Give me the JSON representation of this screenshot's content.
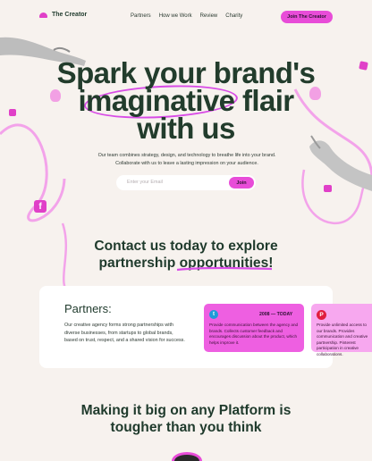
{
  "brand": {
    "name": "The Creator"
  },
  "nav": {
    "items": [
      "Partners",
      "How we Work",
      "Review",
      "Charity"
    ],
    "cta": "Join The Creator"
  },
  "hero": {
    "line1": "Spark your brand's",
    "line2": "imaginative flair",
    "line3": "with us",
    "description": "Our team combines strategy, design, and technology to breathe life into your brand. Collaborate with us to leave a lasting impression on your audience.",
    "email_placeholder": "Enter your Email",
    "join_label": "Join"
  },
  "contact": {
    "line1": "Contact us today to explore",
    "line2": "partnership opportunities!"
  },
  "partners": {
    "title": "Partners:",
    "description": "Our creative agency forms strong partnerships with diverse businesses, from startups to global brands, based on trust, respect, and a shared vision for success.",
    "timeline": [
      {
        "icon": "twitter-icon",
        "year": "2008 — TODAY",
        "text": "Provide communication between the agency and brands. Collects customer feedback and encourages discussion about the product, which helps improve it."
      },
      {
        "icon": "pinterest-icon",
        "text": "Provide unlimited access to our brands. Provides communication and creative partnership. Pinterest participation in creative collaborations."
      }
    ]
  },
  "platform": {
    "line1": "Making it big on any Platform is",
    "line2": "tougher than you think"
  },
  "colors": {
    "accent": "#e84cd8",
    "text": "#1f3a2c",
    "background": "#f7f2ee"
  }
}
